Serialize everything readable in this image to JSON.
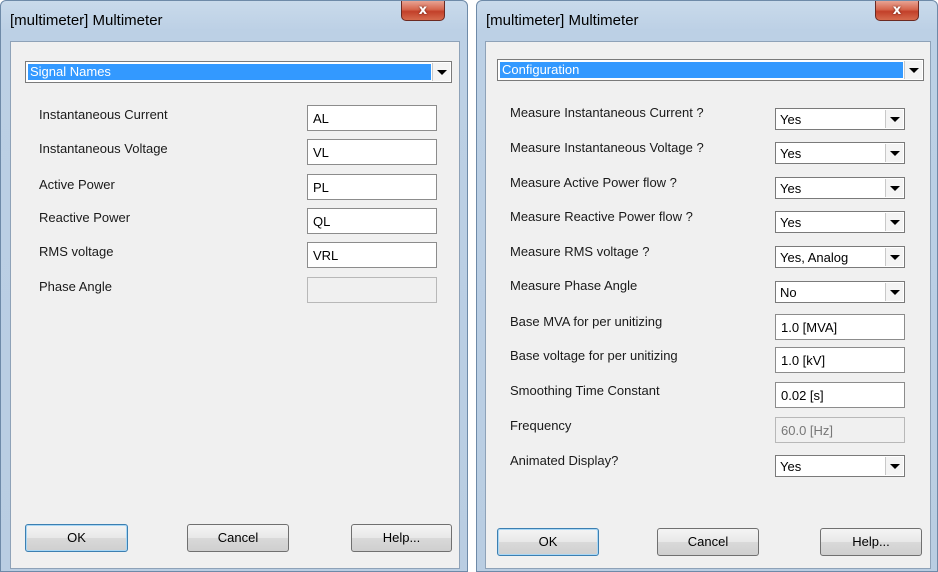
{
  "left_window": {
    "title": "[multimeter] Multimeter",
    "close_label": "x",
    "section_selected": "Signal Names",
    "rows": [
      {
        "label": "Instantaneous Current",
        "value": "AL"
      },
      {
        "label": "Instantaneous Voltage",
        "value": "VL"
      },
      {
        "label": "Active Power",
        "value": "PL"
      },
      {
        "label": "Reactive Power",
        "value": "QL"
      },
      {
        "label": "RMS voltage",
        "value": "VRL"
      },
      {
        "label": "Phase Angle",
        "value": ""
      }
    ],
    "buttons": {
      "ok": "OK",
      "cancel": "Cancel",
      "help": "Help..."
    }
  },
  "right_window": {
    "title": "[multimeter] Multimeter",
    "close_label": "x",
    "section_selected": "Configuration",
    "rows": [
      {
        "label": "Measure Instantaneous Current ?",
        "value": "Yes"
      },
      {
        "label": "Measure Instantaneous Voltage ?",
        "value": "Yes"
      },
      {
        "label": "Measure Active Power flow ?",
        "value": "Yes"
      },
      {
        "label": "Measure Reactive Power flow ?",
        "value": "Yes"
      },
      {
        "label": "Measure RMS voltage ?",
        "value": "Yes, Analog"
      },
      {
        "label": "Measure Phase Angle",
        "value": "No"
      },
      {
        "label": "Base MVA for per unitizing",
        "value": "1.0 [MVA]"
      },
      {
        "label": "Base voltage for per unitizing",
        "value": "1.0 [kV]"
      },
      {
        "label": "Smoothing Time Constant",
        "value": "0.02 [s]"
      },
      {
        "label": "Frequency",
        "value": "60.0 [Hz]"
      },
      {
        "label": "Animated Display?",
        "value": "Yes"
      }
    ],
    "buttons": {
      "ok": "OK",
      "cancel": "Cancel",
      "help": "Help..."
    }
  }
}
